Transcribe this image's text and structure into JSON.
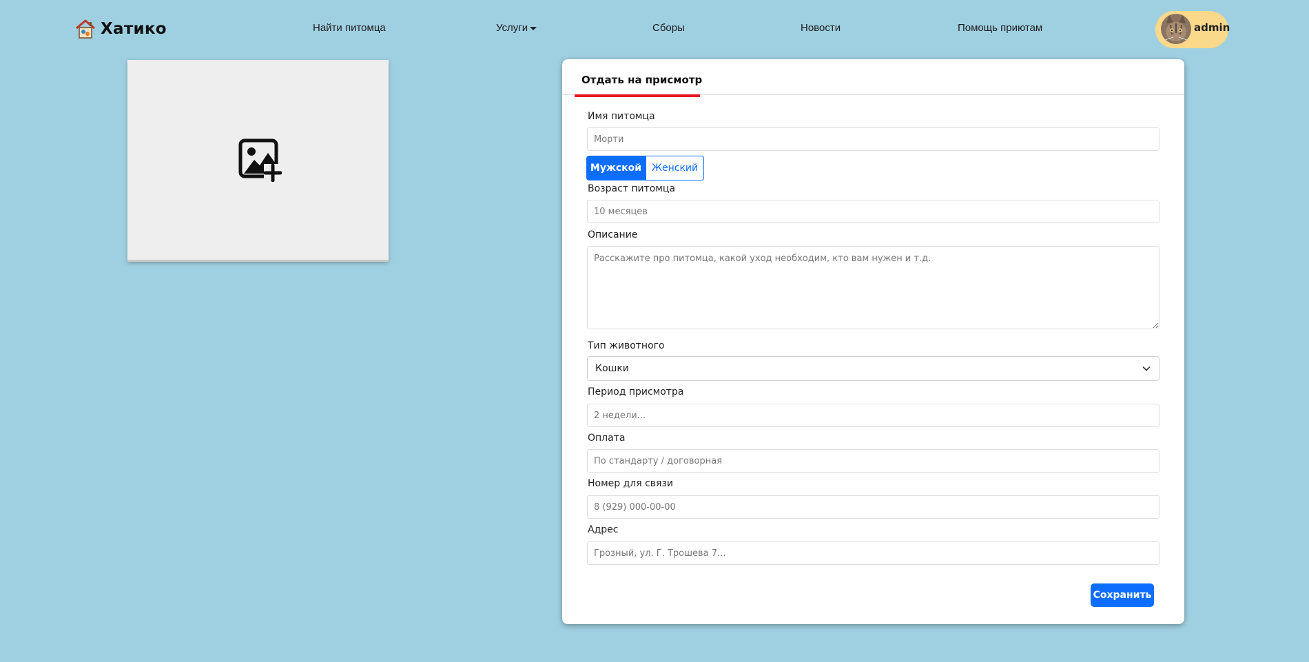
{
  "header": {
    "brand": "Хатико",
    "nav": [
      {
        "label": "Найти питомца"
      },
      {
        "label": "Услуги"
      },
      {
        "label": "Сборы"
      },
      {
        "label": "Новости"
      },
      {
        "label": "Помощь приютам"
      }
    ],
    "user": {
      "name": "admin",
      "avatar_icon": "cat-avatar"
    }
  },
  "upload": {
    "icon": "add-image-icon"
  },
  "form": {
    "tab": "Отдать на присмотр",
    "fields": {
      "pet_name": {
        "label": "Имя питомца",
        "placeholder": "Морти"
      },
      "gender": {
        "options": [
          "Мужской",
          "Женский"
        ],
        "selected": "Мужской"
      },
      "age": {
        "label": "Возраст питомца",
        "placeholder": "10 месяцев"
      },
      "description": {
        "label": "Описание",
        "placeholder": "Расскажите про питомца, какой уход необходим, кто вам нужен и т.д."
      },
      "animal_type": {
        "label": "Тип животного",
        "value": "Кошки"
      },
      "period": {
        "label": "Период присмотра",
        "placeholder": "2 недели..."
      },
      "payment": {
        "label": "Оплата",
        "placeholder": "По стандарту / договорная"
      },
      "phone": {
        "label": "Номер для связи",
        "placeholder": "8 (929) 000-00-00"
      },
      "address": {
        "label": "Адрес",
        "placeholder": "Грозный, ул. Г. Трошева 7..."
      }
    },
    "save_label": "Сохранить"
  },
  "colors": {
    "background": "#9fd0e1",
    "accent": "#0d6efd",
    "tab_underline": "#e4151f",
    "user_pill": "#fbd98a"
  }
}
